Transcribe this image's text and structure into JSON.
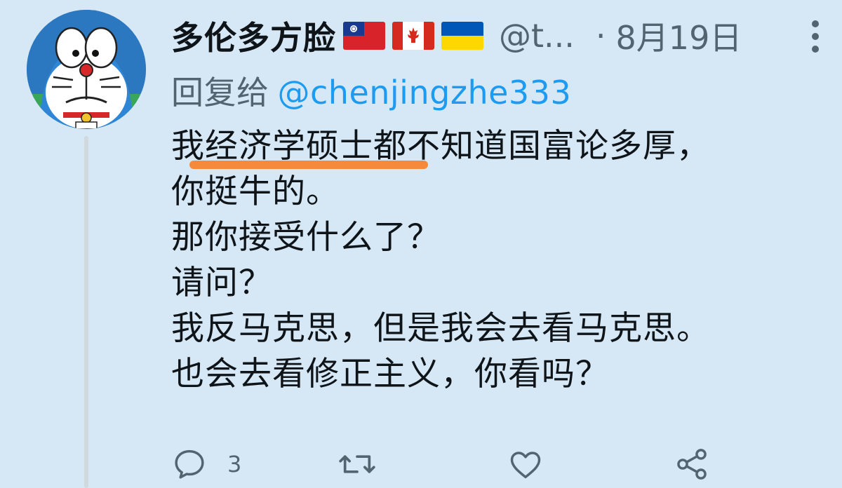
{
  "author": {
    "display_name": "多伦多方脸",
    "handle": "@t...",
    "separator": "·",
    "date": "8月19日",
    "flags": [
      "taiwan-flag",
      "canada-flag",
      "ukraine-flag"
    ]
  },
  "reply": {
    "prefix": "回复给",
    "mention": "@chenjingzhe333"
  },
  "body": {
    "lines": [
      "我经济学硕士都不知道国富论多厚，",
      "你挺牛的。",
      "那你接受什么了？",
      "请问？",
      "我反马克思，但是我会去看马克思。",
      "也会去看修正主义，你看吗？"
    ]
  },
  "actions": {
    "reply_count": "3",
    "icons": [
      "reply-icon",
      "retweet-icon",
      "like-icon",
      "share-icon"
    ]
  },
  "colors": {
    "background": "#d6e8f5",
    "name": "#0f1419",
    "muted": "#536471",
    "link": "#1d9bf0",
    "highlight_underline": "#f58a3c"
  }
}
